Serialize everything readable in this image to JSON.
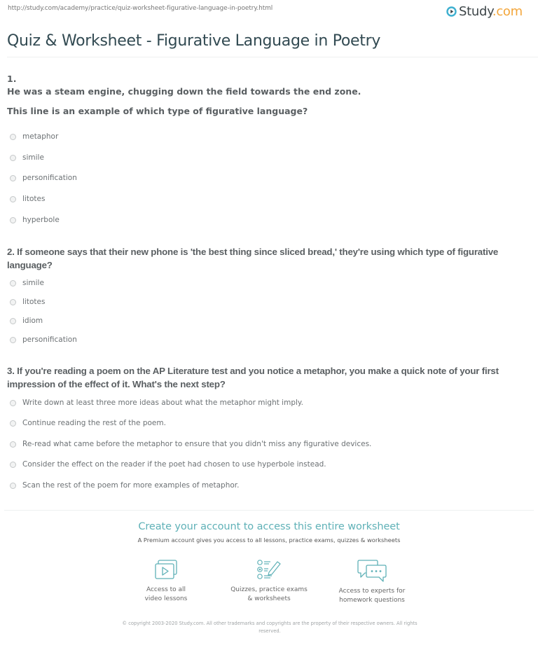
{
  "page": {
    "url": "http://study.com/academy/practice/quiz-worksheet-figurative-language-in-poetry.html",
    "logo": {
      "name": "Study",
      "suffix": ".com",
      "icon": "play-circle-icon",
      "accent_color": "#f3a63b",
      "ring_color": "#3fb0d0"
    },
    "title": "Quiz & Worksheet - Figurative Language in Poetry"
  },
  "questions": [
    {
      "number": "1.",
      "prompt_line": "He was a steam engine, chugging down the field towards the end zone.",
      "question": "This line is an example of which type of figurative language?",
      "options": [
        "metaphor",
        "simile",
        "personification",
        "litotes",
        "hyperbole"
      ]
    },
    {
      "question": "2. If someone says that their new phone is 'the best thing since sliced bread,' they're using which type of figurative language?",
      "options": [
        "simile",
        "litotes",
        "idiom",
        "personification"
      ]
    },
    {
      "question": "3. If you're reading a poem on the AP Literature test and you notice a metaphor, you make a quick note of your first impression of the effect of it. What's the next step?",
      "options": [
        "Write down at least three more ideas about what the metaphor might imply.",
        "Continue reading the rest of the poem.",
        "Re-read what came before the metaphor to ensure that you didn't miss any figurative devices.",
        "Consider the effect on the reader if the poet had chosen to use hyperbole instead.",
        "Scan the rest of the poem for more examples of metaphor."
      ]
    }
  ],
  "cta": {
    "title": "Create your account to access this entire worksheet",
    "subtitle": "A Premium account gives you access to all lessons, practice exams, quizzes & worksheets",
    "accent_color": "#5fb1b7",
    "features": [
      {
        "icon": "video-lessons-icon",
        "line1": "Access to all",
        "line2": "video lessons"
      },
      {
        "icon": "quiz-checklist-icon",
        "line1": "Quizzes, practice exams",
        "line2": "& worksheets"
      },
      {
        "icon": "chat-bubbles-icon",
        "line1": "Access to experts for",
        "line2": "homework questions"
      }
    ]
  },
  "footer": {
    "copyright_line1": "© copyright 2003-2020 Study.com. All other trademarks and copyrights are the property of their respective owners. All rights",
    "copyright_line2": "reserved."
  }
}
